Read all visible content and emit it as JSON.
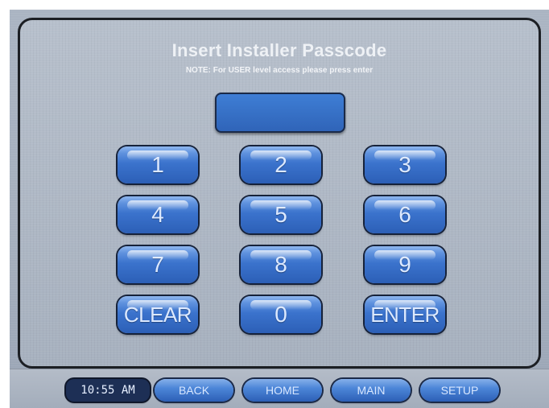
{
  "screen": {
    "title": "Insert Installer Passcode",
    "note": "NOTE: For USER level access please press enter",
    "passcode_value": ""
  },
  "keypad": {
    "keys": [
      "1",
      "2",
      "3",
      "4",
      "5",
      "6",
      "7",
      "8",
      "9",
      "CLEAR",
      "0",
      "ENTER"
    ]
  },
  "nav": {
    "time": "10:55 AM",
    "buttons": [
      "BACK",
      "HOME",
      "MAIN",
      "SETUP"
    ]
  }
}
